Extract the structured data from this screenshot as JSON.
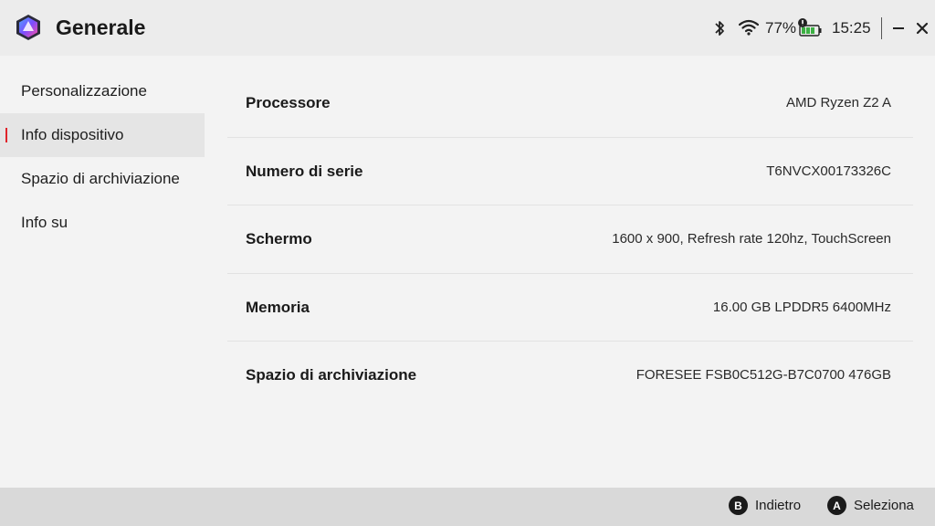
{
  "header": {
    "title": "Generale",
    "battery_percent": "77%",
    "time": "15:25"
  },
  "sidebar": {
    "items": [
      {
        "label": "Personalizzazione",
        "active": false
      },
      {
        "label": "Info dispositivo",
        "active": true
      },
      {
        "label": "Spazio di archiviazione",
        "active": false
      },
      {
        "label": "Info su",
        "active": false
      }
    ]
  },
  "info": {
    "rows": [
      {
        "label": "Processore",
        "value": "AMD Ryzen Z2 A"
      },
      {
        "label": "Numero di serie",
        "value": "T6NVCX00173326C"
      },
      {
        "label": "Schermo",
        "value": "1600 x 900, Refresh rate 120hz, TouchScreen"
      },
      {
        "label": "Memoria",
        "value": "16.00 GB LPDDR5 6400MHz"
      },
      {
        "label": "Spazio di archiviazione",
        "value": "FORESEE FSB0C512G-B7C0700 476GB"
      }
    ]
  },
  "footer": {
    "back": {
      "key": "B",
      "label": "Indietro"
    },
    "select": {
      "key": "A",
      "label": "Seleziona"
    }
  },
  "colors": {
    "accent": "#e0242b",
    "battery_green": "#3cb043",
    "background": "#f3f3f3",
    "titlebar": "#ececec",
    "footer": "#d9d9d9"
  },
  "icons": [
    "app-logo-icon",
    "bluetooth-icon",
    "wifi-icon",
    "battery-icon",
    "minimize-icon",
    "close-icon"
  ]
}
